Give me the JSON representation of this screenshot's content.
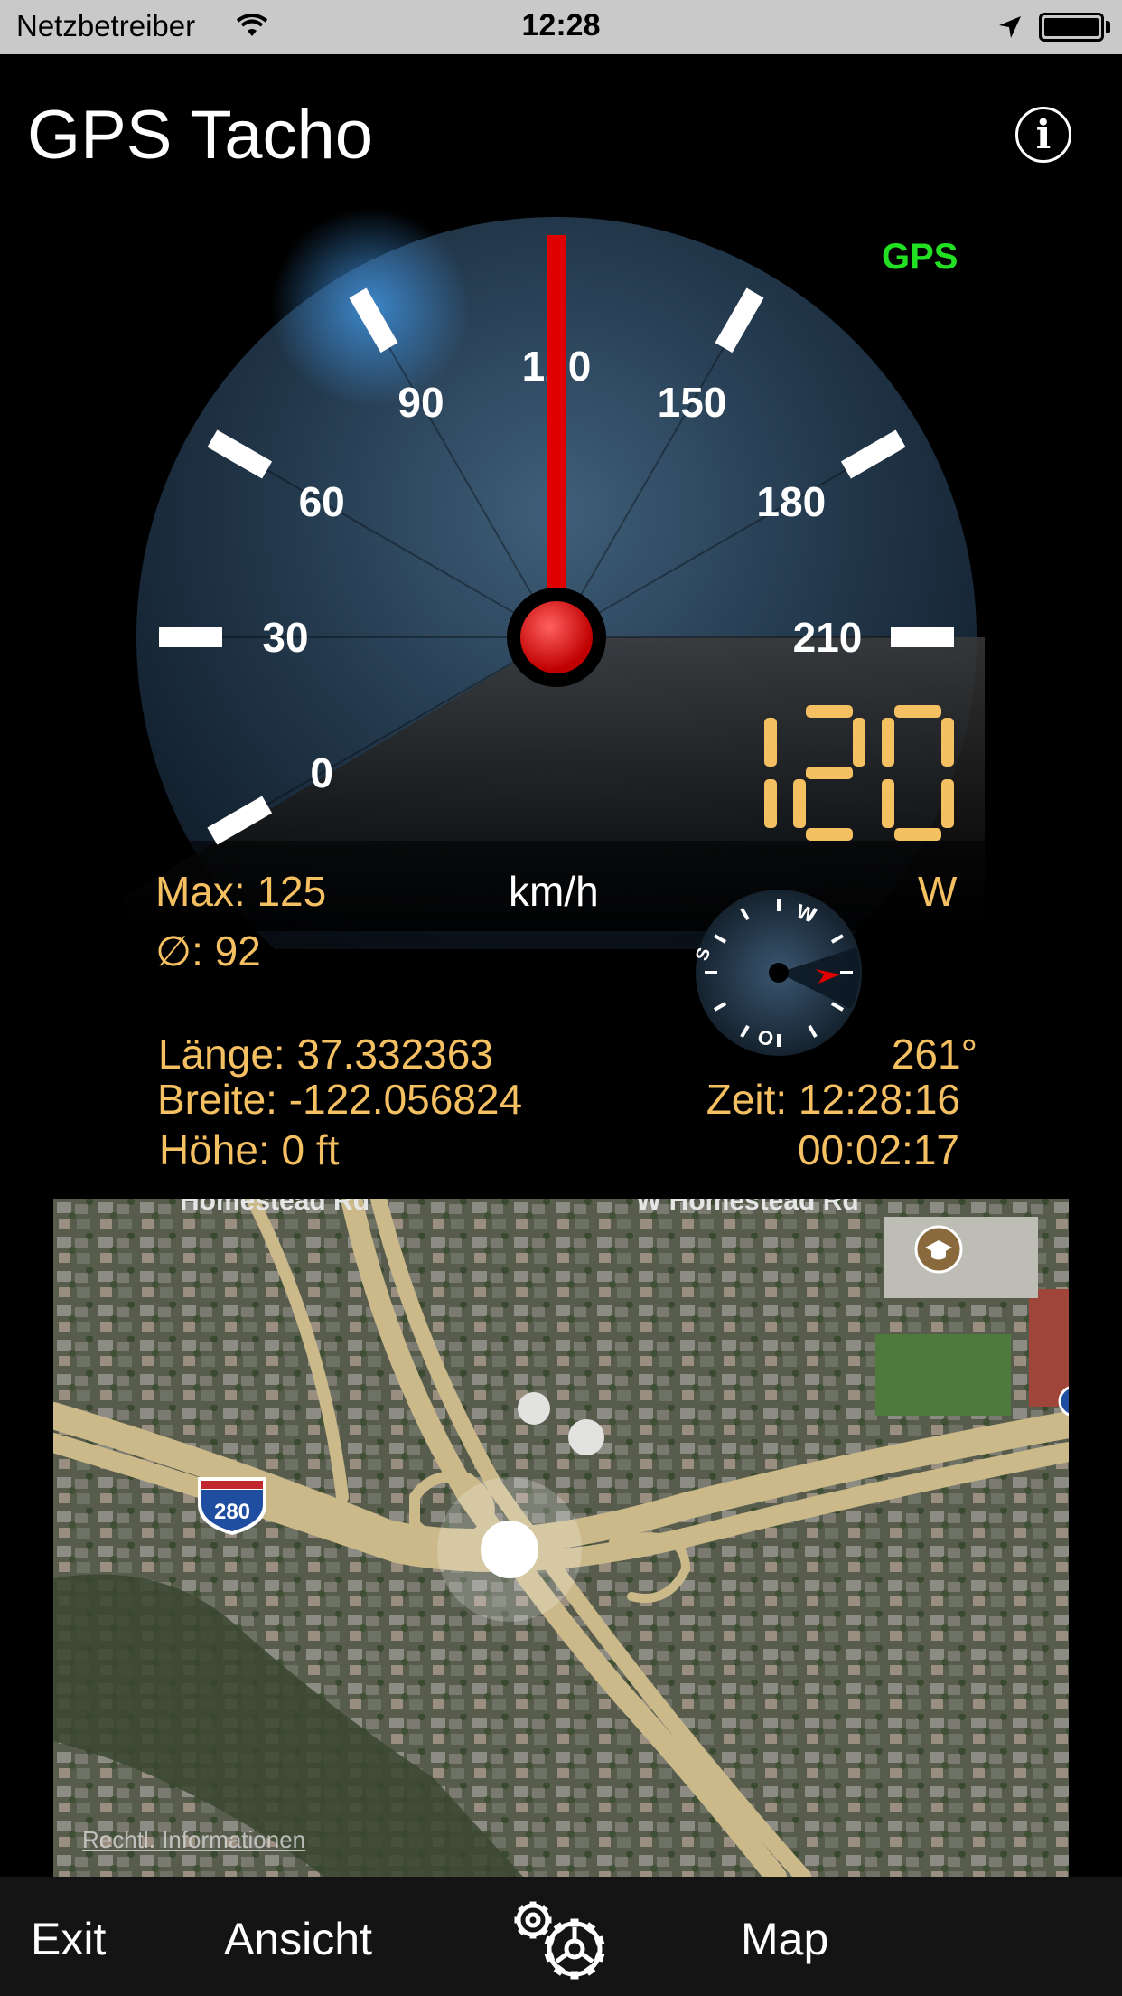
{
  "status_bar": {
    "carrier": "Netzbetreiber",
    "time": "12:28"
  },
  "header": {
    "title": "GPS Tacho",
    "info_icon": "i"
  },
  "gauge": {
    "signal_label": "GPS",
    "signal_color": "#22e022",
    "scale_labels": [
      "0",
      "30",
      "60",
      "90",
      "120",
      "150",
      "180",
      "210"
    ],
    "speed_value": 120,
    "max_scale": 210,
    "needle_color": "#e00000"
  },
  "speed": {
    "digital": "120",
    "unit": "km/h",
    "max": "Max: 125",
    "average": "∅: 92",
    "direction": "W",
    "heading": "261°"
  },
  "compass": {
    "labels": [
      "W",
      "S",
      "O"
    ],
    "accent_color": "#e00000"
  },
  "position": {
    "longitude": "Länge: 37.332363",
    "latitude": "Breite: -122.056824",
    "altitude": "Höhe: 0 ft",
    "time": "Zeit: 12:28:16",
    "duration": "00:02:17"
  },
  "map": {
    "legal_link": "Rechtl. Informationen",
    "road_label_left": "Homestead Rd",
    "road_label_right": "W Homestead Rd",
    "highway_shield": "280",
    "school_icon": "graduation-cap-icon"
  },
  "toolbar": {
    "exit": "Exit",
    "view": "Ansicht",
    "settings_icon": "gears-icon",
    "map": "Map"
  },
  "colors": {
    "amber": "#f5c062",
    "background": "#000000"
  }
}
